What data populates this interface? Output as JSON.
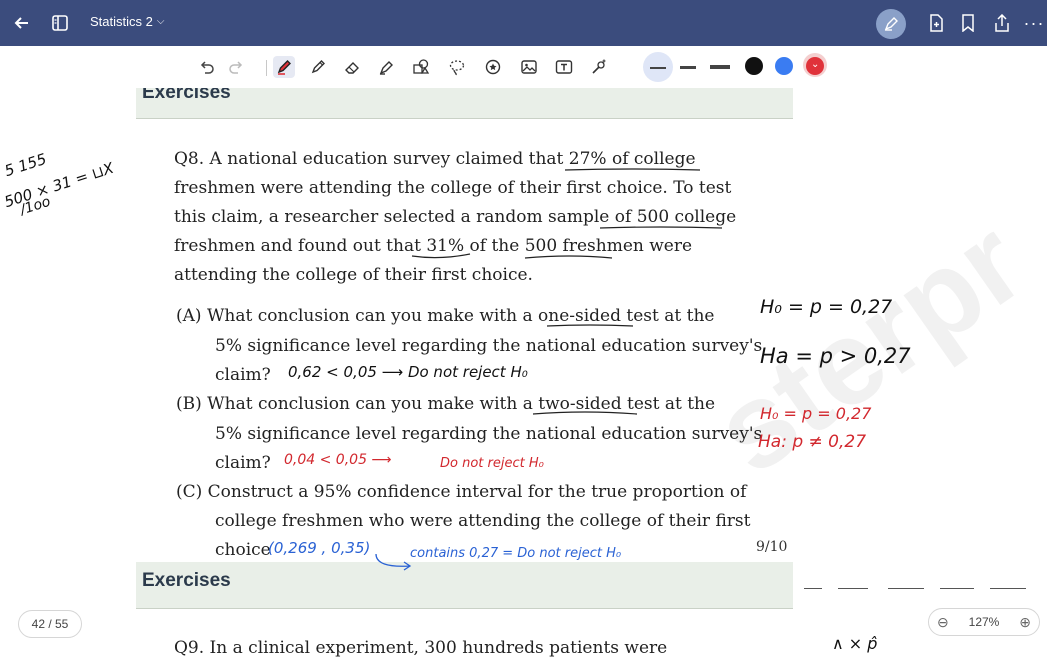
{
  "header": {
    "title": "Statistics 2",
    "icons": [
      "back-arrow-icon",
      "sidebar-icon",
      "pen-settings-icon",
      "add-page-icon",
      "bookmark-icon",
      "share-icon",
      "more-icon"
    ]
  },
  "toolbar": {
    "tools": [
      "undo-icon",
      "redo-icon",
      "pen-icon",
      "pencil-icon",
      "eraser-icon",
      "highlighter-icon",
      "shapes-icon",
      "lasso-icon",
      "sticker-icon",
      "image-icon",
      "text-icon",
      "magic-icon"
    ],
    "colors": [
      "#111111",
      "#3a7cf2",
      "#e0323a"
    ]
  },
  "doc": {
    "section_top": "Exercises",
    "q8_lines": [
      "Q8. A national education survey claimed that 27% of college",
      "freshmen were attending the college of their first choice.  To test",
      "this claim, a researcher selected a random sample of 500 college",
      "freshmen and found out that 31% of the 500 freshmen were",
      "attending the college of their first choice."
    ],
    "a_lines": [
      "(A) What conclusion can you make with a one-sided test at the",
      "5% significance level regarding the national education survey's",
      "claim?"
    ],
    "b_lines": [
      "(B) What conclusion can you make with a two-sided test at the",
      "5% significance level regarding the national education survey's",
      "claim?"
    ],
    "c_lines": [
      "(C) Construct a 95% confidence interval for the true proportion of",
      "college freshmen who were attending the college of their first",
      "choice"
    ],
    "page_label": "9/10",
    "section_bottom": "Exercises",
    "q9_line": "Q9.  In a clinical experiment, 300 hundreds patients were"
  },
  "notes": {
    "left_calc_top": "5          155",
    "left_calc_mid": "500 × 31  =      ⊔X",
    "left_calc_bot": "      /1oo",
    "a_answer": "0,62 < 0,05  ⟶  Do not reject H₀",
    "b_answer_value": "0,04 < 0,05 ⟶",
    "b_answer_text": "Do not reject H₀",
    "c_answer_interval": "(0,269   , 0,35)",
    "c_answer_text": "contains  0,27 = Do not reject H₀",
    "h0_black": "H₀ = p = 0,27",
    "ha_black": "Ha = p > 0,27",
    "h0_red": "H₀ = p = 0,27",
    "ha_red": "Ha: p ≠ 0,27",
    "bottom_marks": "∧        ×        p̂"
  },
  "footer": {
    "page_indicator": "42 / 55",
    "zoom_level": "127%"
  }
}
